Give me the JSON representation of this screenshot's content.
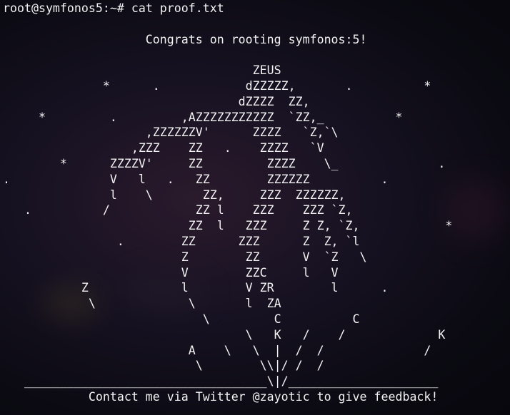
{
  "terminal": {
    "prompt": "root@symfonos5:~#",
    "command": "cat proof.txt",
    "output_lines": [
      "",
      "                    Congrats on rooting symfonos:5!",
      "",
      "                                   ZEUS",
      "              *      .            dZZZZZ,       .          *",
      "                                 dZZZZ  ZZ,",
      "     *         .         ,AZZZZZZZZZZZ  `ZZ,_          *",
      "                    ,ZZZZZZV'      ZZZZ   `Z,`\\",
      "                  ,ZZZ    ZZ   .    ZZZZ   `V",
      "        *      ZZZZV'     ZZ         ZZZZ    \\_              .",
      ".              V   l   .   ZZ        ZZZZZZ          .",
      "               l    \\       ZZ,     ZZZ  ZZZZZZ,",
      "   .          /            ZZ l    ZZZ    ZZZ `Z,",
      "                          ZZ  l   ZZZ     Z Z, `Z,            *",
      "                .        ZZ      ZZZ      Z  Z, `l",
      "                         Z        ZZ      V  `Z   \\",
      "                         V        ZZC     l   V",
      "           Z             l        V ZR        l      .",
      "            \\             \\       l  ZA",
      "                            \\         C          C",
      "                                  \\   K   /    /             K",
      "                          A    \\   \\  |  /  /              /",
      "                           \\        \\\\|/ /  /",
      "   __________________________________\\|/_____________________",
      "            Contact me via Twitter @zayotic to give feedback!"
    ]
  }
}
